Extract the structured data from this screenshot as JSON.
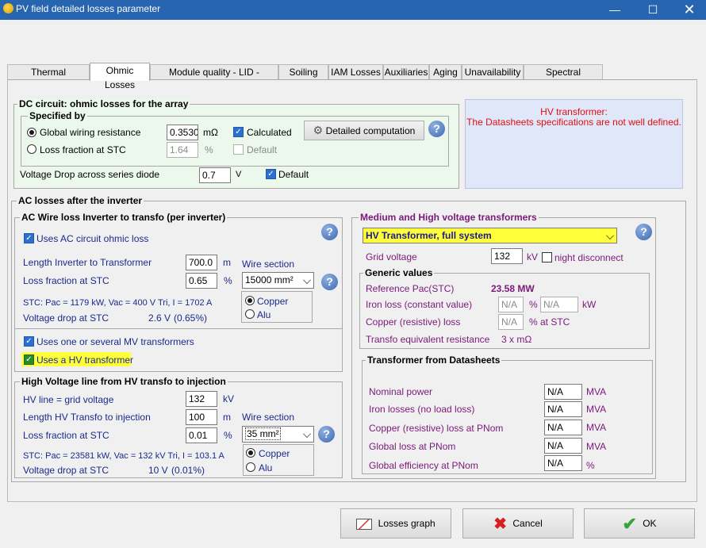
{
  "window": {
    "title": "PV field detailed losses parameter"
  },
  "tabs": [
    "Thermal parameter",
    "Ohmic Losses",
    "Module quality - LID - Mismatch",
    "Soiling Loss",
    "IAM Losses",
    "Auxiliaries",
    "Aging",
    "Unavailability",
    "Spectral correction"
  ],
  "dc": {
    "title": "DC circuit: ohmic losses for the array",
    "specified_by": "Specified by",
    "global_wiring_label": "Global wiring resistance",
    "global_wiring_value": "0.3530",
    "global_wiring_unit": "mΩ",
    "calculated_label": "Calculated",
    "loss_fraction_label": "Loss fraction at STC",
    "loss_fraction_value": "1.64",
    "loss_fraction_unit": "%",
    "default_label": "Default",
    "detailed_btn": "Detailed computation",
    "vdrop_label": "Voltage Drop across series diode",
    "vdrop_value": "0.7",
    "vdrop_unit": "V",
    "vdrop_default": "Default"
  },
  "warning": {
    "line1": "HV transformer:",
    "line2": "The Datasheets specifications are not well defined."
  },
  "ac": {
    "title": "AC losses after the inverter",
    "wire": {
      "title": "AC Wire loss Inverter to transfo  (per inverter)",
      "uses_ac": "Uses AC circuit ohmic loss",
      "length_label": "Length Inverter to Transformer",
      "length_value": "700.0",
      "length_unit": "m",
      "wire_section_label": "Wire section",
      "loss_label": "Loss fraction at STC",
      "loss_value": "0.65",
      "loss_unit": "%",
      "section_value": "15000 mm²",
      "stc_line": "STC: Pac = 1179 kW,  Vac = 400 V Tri,  I = 1702 A",
      "copper": "Copper",
      "alu": "Alu",
      "vdrop_label": "Voltage drop at STC",
      "vdrop_value": "2.6 V",
      "vdrop_pct": "(0.65%)",
      "uses_mv": "Uses one or several MV transformers",
      "uses_hv": "Uses a HV transformer"
    },
    "hvline": {
      "title": "High Voltage line from HV transfo to injection",
      "hv_label": "HV line = grid voltage",
      "hv_value": "132",
      "hv_unit": "kV",
      "length_label": "Length HV Transfo to injection",
      "length_value": "100",
      "length_unit": "m",
      "wire_section_label": "Wire section",
      "loss_label": "Loss fraction at STC",
      "loss_value": "0.01",
      "loss_unit": "%",
      "section_value": "35 mm²",
      "stc_line": "STC: Pac = 23581 kW,  Vac = 132 kV Tri,  I = 103.1 A",
      "copper": "Copper",
      "alu": "Alu",
      "vdrop_label": "Voltage drop at STC",
      "vdrop_value": "10 V",
      "vdrop_pct": "(0.01%)"
    },
    "mv": {
      "title": "Medium and High voltage transformers",
      "select_value": "HV Transformer, full system",
      "grid_label": "Grid voltage",
      "grid_value": "132",
      "grid_unit": "kV",
      "night_label": "night disconnect",
      "generic_title": "Generic values",
      "ref_label": "Reference Pac(STC)",
      "ref_value": "23.58 MW",
      "iron_label": "Iron loss (constant value)",
      "iron_v1": "N/A",
      "iron_u1": "%",
      "iron_v2": "N/A",
      "iron_u2": "kW",
      "copper_label": "Copper (resistive) loss",
      "copper_value": "N/A",
      "copper_unit": "% at STC",
      "equiv_label": "Transfo equivalent resistance",
      "equiv_value": "3 x  mΩ"
    },
    "ds": {
      "title": "Transformer from Datasheets",
      "rows": [
        {
          "label": "Nominal power",
          "value": "N/A",
          "unit": "MVA"
        },
        {
          "label": "Iron losses (no load loss)",
          "value": "N/A",
          "unit": "MVA"
        },
        {
          "label": "Copper (resistive) loss at PNom",
          "value": "N/A",
          "unit": "MVA"
        },
        {
          "label": "Global loss at PNom",
          "value": "N/A",
          "unit": "MVA"
        },
        {
          "label": "Global efficiency at PNom",
          "value": "N/A",
          "unit": "%"
        }
      ]
    }
  },
  "footer": {
    "graph": "Losses graph",
    "cancel": "Cancel",
    "ok": "OK"
  }
}
